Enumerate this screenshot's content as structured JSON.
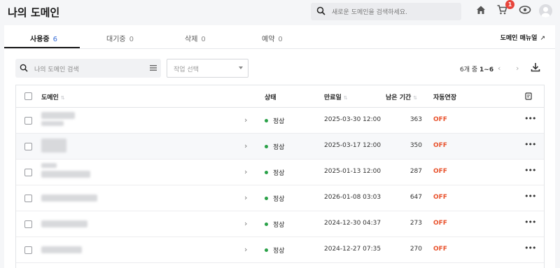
{
  "header": {
    "title": "나의 도메인",
    "search_placeholder": "새로운 도메인을 검색하세요.",
    "cart_badge": "1",
    "icons": [
      "home-icon",
      "cart-icon",
      "support-icon",
      "avatar"
    ]
  },
  "tabs": [
    {
      "label": "사용중",
      "count": "6",
      "active": true
    },
    {
      "label": "대기중",
      "count": "0",
      "active": false
    },
    {
      "label": "삭제",
      "count": "0",
      "active": false
    },
    {
      "label": "예약",
      "count": "0",
      "active": false
    }
  ],
  "manual_link": "도메인 매뉴얼",
  "filters": {
    "search_placeholder": "나의 도메인 검색",
    "task_select_placeholder": "작업 선택"
  },
  "pagination": {
    "summary_prefix": "6개 중",
    "summary_range": "1~6"
  },
  "table": {
    "columns": {
      "domain": "도메인",
      "status": "상태",
      "expiry": "만료일",
      "remaining": "남은 기간",
      "auto_renew": "자동연장"
    },
    "rows": [
      {
        "status": "정상",
        "expiry": "2025-03-30 12:00",
        "remaining": "363",
        "auto_renew": "OFF"
      },
      {
        "status": "정상",
        "expiry": "2025-03-17 12:00",
        "remaining": "350",
        "auto_renew": "OFF"
      },
      {
        "status": "정상",
        "expiry": "2025-01-13 12:00",
        "remaining": "287",
        "auto_renew": "OFF"
      },
      {
        "status": "정상",
        "expiry": "2026-01-08 03:03",
        "remaining": "647",
        "auto_renew": "OFF"
      },
      {
        "status": "정상",
        "expiry": "2024-12-30 04:37",
        "remaining": "273",
        "auto_renew": "OFF"
      },
      {
        "status": "정상",
        "expiry": "2024-12-27 07:35",
        "remaining": "270",
        "auto_renew": "OFF"
      }
    ]
  },
  "colors": {
    "active_count": "#3a6fd8",
    "status_ok": "#2aa148",
    "auto_renew_off": "#e8522c",
    "badge": "#e8453c"
  }
}
